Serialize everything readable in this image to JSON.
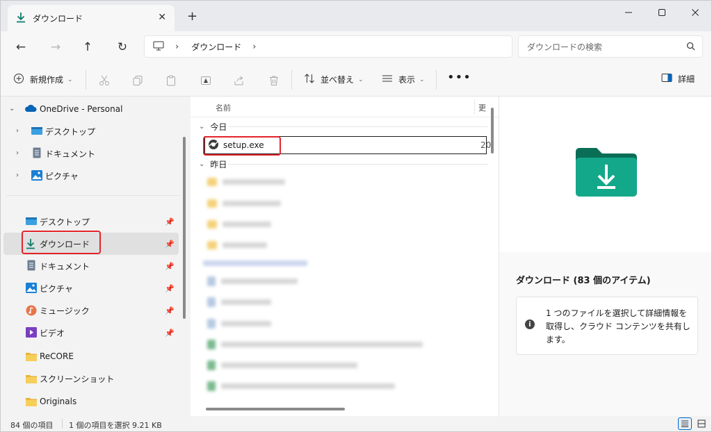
{
  "tab": {
    "title": "ダウンロード"
  },
  "address": {
    "crumb": "ダウンロード"
  },
  "search": {
    "placeholder": "ダウンロードの検索"
  },
  "toolbar": {
    "new_label": "新規作成",
    "sort_label": "並べ替え",
    "view_label": "表示",
    "details_label": "詳細"
  },
  "nav": {
    "onedrive": "OneDrive - Personal",
    "od_items": [
      "デスクトップ",
      "ドキュメント",
      "ピクチャ"
    ],
    "quick": [
      "デスクトップ",
      "ダウンロード",
      "ドキュメント",
      "ピクチャ",
      "ミュージック",
      "ビデオ"
    ],
    "folders": [
      "ReCORE",
      "スクリーンショット",
      "Originals"
    ]
  },
  "list": {
    "col_name": "名前",
    "col_date": "更",
    "group_today": "今日",
    "group_yesterday": "昨日",
    "file_name": "setup.exe",
    "file_date": "20"
  },
  "details": {
    "title": "ダウンロード (83 個のアイテム)",
    "info": "1 つのファイルを選択して詳細情報を取得し、クラウド コンテンツを共有します。"
  },
  "status": {
    "count": "84 個の項目",
    "selection": "1 個の項目を選択 9.21 KB"
  },
  "colors": {
    "accent": "#0f7b6c",
    "highlight": "#e3242b",
    "folder": "#e8b53b"
  }
}
